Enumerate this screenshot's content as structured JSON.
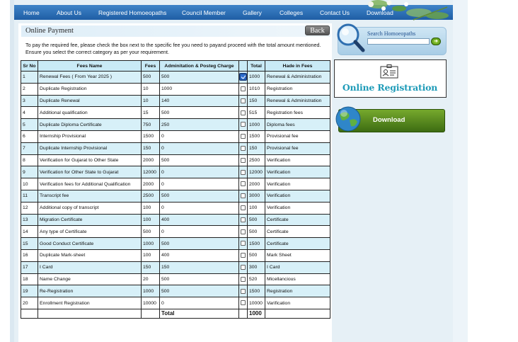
{
  "nav": {
    "items": [
      "Home",
      "About Us",
      "Registered Homoeopaths",
      "Council Member",
      "Gallery",
      "Colleges",
      "Contact Us",
      "Download"
    ]
  },
  "payment": {
    "title": "Online Payment",
    "back_label": "Back",
    "instructions": "To pay the required fee, please check the box next to the specific fee you need to payand proceed with the total amount mentioned. Ensure you select the correct category as per your requirement."
  },
  "table": {
    "headers": {
      "sr": "Sr No",
      "name": "Fees Name",
      "fees": "Fees",
      "admin": "Adminitation & Posteg Charge",
      "total": "Total",
      "head": "Hade in Fees"
    },
    "rows": [
      {
        "sr": "1",
        "name": "Renewal Fees ( From Year 2025 )",
        "fees": "500",
        "admin": "500",
        "total": "1000",
        "head": "Renewal & Administration",
        "checked": true
      },
      {
        "sr": "2",
        "name": "Duplicate Registration",
        "fees": "10",
        "admin": "1000",
        "total": "1010",
        "head": "Registration",
        "checked": false
      },
      {
        "sr": "3",
        "name": "Duplicate Renewal",
        "fees": "10",
        "admin": "140",
        "total": "150",
        "head": "Renewal & Administration",
        "checked": false
      },
      {
        "sr": "4",
        "name": "Additional qualification",
        "fees": "15",
        "admin": "500",
        "total": "515",
        "head": "Registration fees",
        "checked": false
      },
      {
        "sr": "5",
        "name": "Duplicate Diploma Certificate",
        "fees": "750",
        "admin": "250",
        "total": "1000",
        "head": "Diploma fees",
        "checked": false
      },
      {
        "sr": "6",
        "name": "Internship Provisional",
        "fees": "1500",
        "admin": "0",
        "total": "1500",
        "head": "Provisional fee",
        "checked": false
      },
      {
        "sr": "7",
        "name": "Duplicate Internship Provisional",
        "fees": "150",
        "admin": "0",
        "total": "150",
        "head": "Provisional fee",
        "checked": false
      },
      {
        "sr": "8",
        "name": "Verification for Gujarat to Other State",
        "fees": "2000",
        "admin": "500",
        "total": "2500",
        "head": "Verification",
        "checked": false
      },
      {
        "sr": "9",
        "name": "Verification for Other State to Gujarat",
        "fees": "12000",
        "admin": "0",
        "total": "12000",
        "head": "Verification",
        "checked": false
      },
      {
        "sr": "10",
        "name": "Verification fees for Additional Qualification",
        "fees": "2000",
        "admin": "0",
        "total": "2000",
        "head": "Verification",
        "checked": false
      },
      {
        "sr": "11",
        "name": "Transcript fee",
        "fees": "2500",
        "admin": "500",
        "total": "3000",
        "head": "Verification",
        "checked": false
      },
      {
        "sr": "12",
        "name": "Additional copy of transcript",
        "fees": "100",
        "admin": "0",
        "total": "100",
        "head": "Verification",
        "checked": false
      },
      {
        "sr": "13",
        "name": "Migration Certificate",
        "fees": "100",
        "admin": "400",
        "total": "500",
        "head": "Certificate",
        "checked": false
      },
      {
        "sr": "14",
        "name": "Any type of Certificate",
        "fees": "500",
        "admin": "0",
        "total": "500",
        "head": "Certificate",
        "checked": false
      },
      {
        "sr": "15",
        "name": "Good Conduct Certificate",
        "fees": "1000",
        "admin": "500",
        "total": "1500",
        "head": "Certificate",
        "checked": false
      },
      {
        "sr": "16",
        "name": "Duplicate Mark-sheet",
        "fees": "100",
        "admin": "400",
        "total": "500",
        "head": "Mark Sheet",
        "checked": false
      },
      {
        "sr": "17",
        "name": "I Card",
        "fees": "150",
        "admin": "150",
        "total": "300",
        "head": "I Card",
        "checked": false
      },
      {
        "sr": "18",
        "name": "Name Change",
        "fees": "20",
        "admin": "500",
        "total": "520",
        "head": "Micellancious",
        "checked": false
      },
      {
        "sr": "19",
        "name": "Re-Registration",
        "fees": "1000",
        "admin": "500",
        "total": "1500",
        "head": "Registration",
        "checked": false
      },
      {
        "sr": "20",
        "name": "Enrollment Registration",
        "fees": "10000",
        "admin": "0",
        "total": "10000",
        "head": "Varification",
        "checked": false
      }
    ],
    "total_label": "Total",
    "total_value": "1000"
  },
  "sidebar": {
    "search_title": "Search Homoeopaths",
    "search_value": "",
    "online_registration": "Online Registration",
    "download_label": "Download"
  },
  "colors": {
    "nav": "#2a6db5",
    "row_alt": "#d7f0f8",
    "registration_text": "#1e9bb8",
    "download_green": "#5a8d1f"
  }
}
